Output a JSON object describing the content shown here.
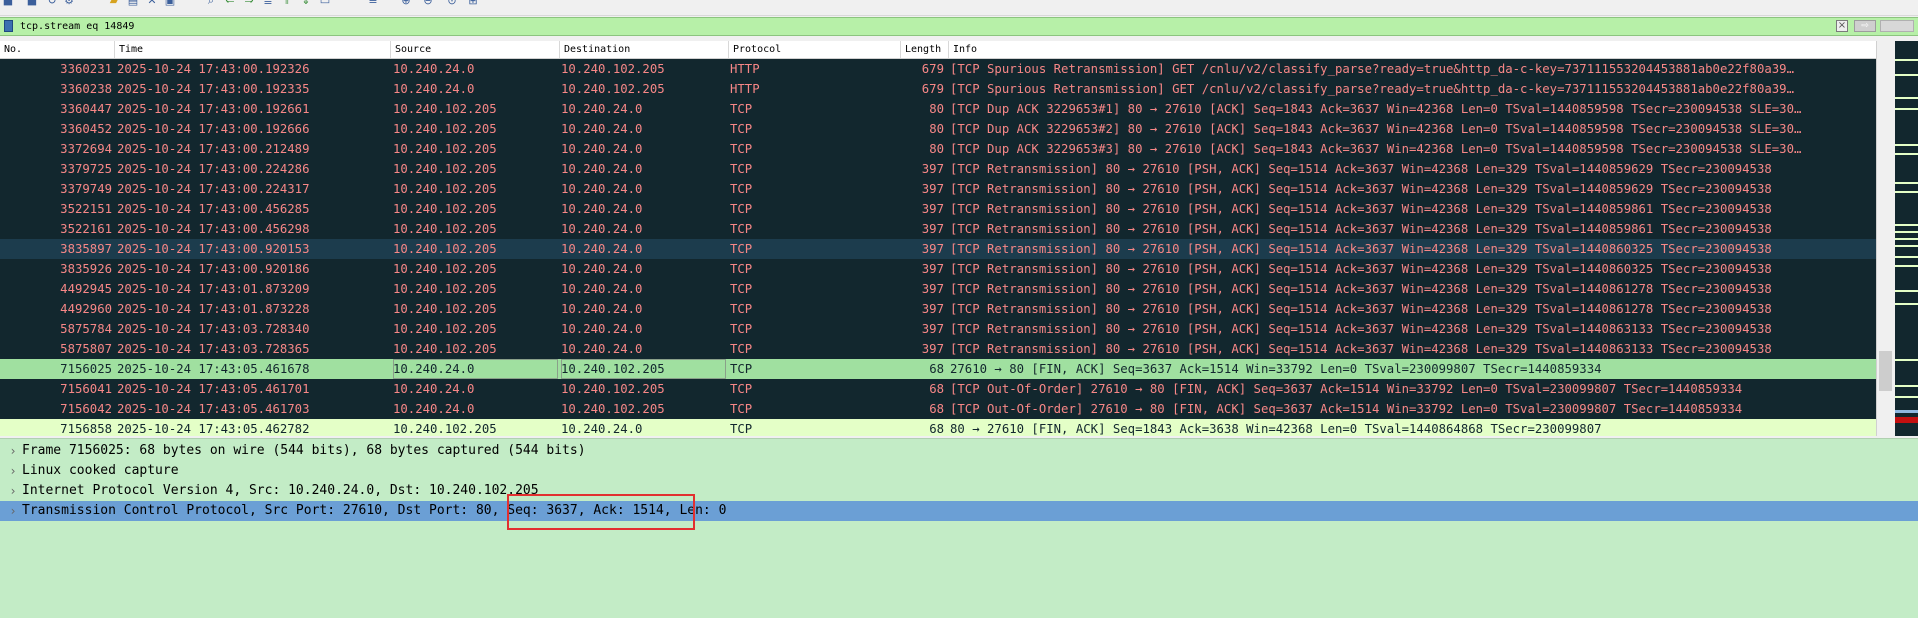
{
  "toolbar": {
    "icons": [
      "stop-icon",
      "restart-icon",
      "options-icon",
      "open-icon",
      "save-icon",
      "close-file-icon",
      "reload-icon",
      "find-icon",
      "go-back-icon",
      "go-forward-icon",
      "go-to-icon",
      "first-icon",
      "last-icon",
      "autoscroll-icon",
      "colorize-icon",
      "zoom-in-icon",
      "zoom-out-icon",
      "zoom-normal-icon",
      "resize-columns-icon"
    ]
  },
  "filter": {
    "value": "tcp.stream eq 14849",
    "clear_icon": "×",
    "apply_icon": "⇨"
  },
  "columns": {
    "no": "No.",
    "time": "Time",
    "source": "Source",
    "destination": "Destination",
    "protocol": "Protocol",
    "length": "Length",
    "info": "Info"
  },
  "packets": [
    {
      "no": "3360231",
      "time": "2025-10-24 17:43:00.192326",
      "src": "10.240.24.0",
      "dst": "10.240.102.205",
      "proto": "HTTP",
      "len": "679",
      "info": "[TCP Spurious Retransmission] GET /cnlu/v2/classify_parse?ready=true&http_da-c-key=737111553204453881ab0e22f80a39…"
    },
    {
      "no": "3360238",
      "time": "2025-10-24 17:43:00.192335",
      "src": "10.240.24.0",
      "dst": "10.240.102.205",
      "proto": "HTTP",
      "len": "679",
      "info": "[TCP Spurious Retransmission] GET /cnlu/v2/classify_parse?ready=true&http_da-c-key=737111553204453881ab0e22f80a39…"
    },
    {
      "no": "3360447",
      "time": "2025-10-24 17:43:00.192661",
      "src": "10.240.102.205",
      "dst": "10.240.24.0",
      "proto": "TCP",
      "len": "80",
      "info": "[TCP Dup ACK 3229653#1] 80 → 27610 [ACK] Seq=1843 Ack=3637 Win=42368 Len=0 TSval=1440859598 TSecr=230094538 SLE=30…"
    },
    {
      "no": "3360452",
      "time": "2025-10-24 17:43:00.192666",
      "src": "10.240.102.205",
      "dst": "10.240.24.0",
      "proto": "TCP",
      "len": "80",
      "info": "[TCP Dup ACK 3229653#2] 80 → 27610 [ACK] Seq=1843 Ack=3637 Win=42368 Len=0 TSval=1440859598 TSecr=230094538 SLE=30…"
    },
    {
      "no": "3372694",
      "time": "2025-10-24 17:43:00.212489",
      "src": "10.240.102.205",
      "dst": "10.240.24.0",
      "proto": "TCP",
      "len": "80",
      "info": "[TCP Dup ACK 3229653#3] 80 → 27610 [ACK] Seq=1843 Ack=3637 Win=42368 Len=0 TSval=1440859598 TSecr=230094538 SLE=30…"
    },
    {
      "no": "3379725",
      "time": "2025-10-24 17:43:00.224286",
      "src": "10.240.102.205",
      "dst": "10.240.24.0",
      "proto": "TCP",
      "len": "397",
      "info": "[TCP Retransmission] 80 → 27610 [PSH, ACK] Seq=1514 Ack=3637 Win=42368 Len=329 TSval=1440859629 TSecr=230094538"
    },
    {
      "no": "3379749",
      "time": "2025-10-24 17:43:00.224317",
      "src": "10.240.102.205",
      "dst": "10.240.24.0",
      "proto": "TCP",
      "len": "397",
      "info": "[TCP Retransmission] 80 → 27610 [PSH, ACK] Seq=1514 Ack=3637 Win=42368 Len=329 TSval=1440859629 TSecr=230094538"
    },
    {
      "no": "3522151",
      "time": "2025-10-24 17:43:00.456285",
      "src": "10.240.102.205",
      "dst": "10.240.24.0",
      "proto": "TCP",
      "len": "397",
      "info": "[TCP Retransmission] 80 → 27610 [PSH, ACK] Seq=1514 Ack=3637 Win=42368 Len=329 TSval=1440859861 TSecr=230094538"
    },
    {
      "no": "3522161",
      "time": "2025-10-24 17:43:00.456298",
      "src": "10.240.102.205",
      "dst": "10.240.24.0",
      "proto": "TCP",
      "len": "397",
      "info": "[TCP Retransmission] 80 → 27610 [PSH, ACK] Seq=1514 Ack=3637 Win=42368 Len=329 TSval=1440859861 TSecr=230094538"
    },
    {
      "no": "3835897",
      "time": "2025-10-24 17:43:00.920153",
      "src": "10.240.102.205",
      "dst": "10.240.24.0",
      "proto": "TCP",
      "len": "397",
      "info": "[TCP Retransmission] 80 → 27610 [PSH, ACK] Seq=1514 Ack=3637 Win=42368 Len=329 TSval=1440860325 TSecr=230094538"
    },
    {
      "no": "3835926",
      "time": "2025-10-24 17:43:00.920186",
      "src": "10.240.102.205",
      "dst": "10.240.24.0",
      "proto": "TCP",
      "len": "397",
      "info": "[TCP Retransmission] 80 → 27610 [PSH, ACK] Seq=1514 Ack=3637 Win=42368 Len=329 TSval=1440860325 TSecr=230094538"
    },
    {
      "no": "4492945",
      "time": "2025-10-24 17:43:01.873209",
      "src": "10.240.102.205",
      "dst": "10.240.24.0",
      "proto": "TCP",
      "len": "397",
      "info": "[TCP Retransmission] 80 → 27610 [PSH, ACK] Seq=1514 Ack=3637 Win=42368 Len=329 TSval=1440861278 TSecr=230094538"
    },
    {
      "no": "4492960",
      "time": "2025-10-24 17:43:01.873228",
      "src": "10.240.102.205",
      "dst": "10.240.24.0",
      "proto": "TCP",
      "len": "397",
      "info": "[TCP Retransmission] 80 → 27610 [PSH, ACK] Seq=1514 Ack=3637 Win=42368 Len=329 TSval=1440861278 TSecr=230094538"
    },
    {
      "no": "5875784",
      "time": "2025-10-24 17:43:03.728340",
      "src": "10.240.102.205",
      "dst": "10.240.24.0",
      "proto": "TCP",
      "len": "397",
      "info": "[TCP Retransmission] 80 → 27610 [PSH, ACK] Seq=1514 Ack=3637 Win=42368 Len=329 TSval=1440863133 TSecr=230094538"
    },
    {
      "no": "5875807",
      "time": "2025-10-24 17:43:03.728365",
      "src": "10.240.102.205",
      "dst": "10.240.24.0",
      "proto": "TCP",
      "len": "397",
      "info": "[TCP Retransmission] 80 → 27610 [PSH, ACK] Seq=1514 Ack=3637 Win=42368 Len=329 TSval=1440863133 TSecr=230094538"
    },
    {
      "no": "7156025",
      "time": "2025-10-24 17:43:05.461678",
      "src": "10.240.24.0",
      "dst": "10.240.102.205",
      "proto": "TCP",
      "len": "68",
      "info": "27610 → 80 [FIN, ACK] Seq=3637 Ack=1514 Win=33792 Len=0 TSval=230099807 TSecr=1440859334"
    },
    {
      "no": "7156041",
      "time": "2025-10-24 17:43:05.461701",
      "src": "10.240.24.0",
      "dst": "10.240.102.205",
      "proto": "TCP",
      "len": "68",
      "info": "[TCP Out-Of-Order] 27610 → 80 [FIN, ACK] Seq=3637 Ack=1514 Win=33792 Len=0 TSval=230099807 TSecr=1440859334"
    },
    {
      "no": "7156042",
      "time": "2025-10-24 17:43:05.461703",
      "src": "10.240.24.0",
      "dst": "10.240.102.205",
      "proto": "TCP",
      "len": "68",
      "info": "[TCP Out-Of-Order] 27610 → 80 [FIN, ACK] Seq=3637 Ack=1514 Win=33792 Len=0 TSval=230099807 TSecr=1440859334"
    },
    {
      "no": "7156858",
      "time": "2025-10-24 17:43:05.462782",
      "src": "10.240.102.205",
      "dst": "10.240.24.0",
      "proto": "TCP",
      "len": "68",
      "info": "80 → 27610 [FIN, ACK] Seq=1843 Ack=3638 Win=42368 Len=0 TSval=1440864868 TSecr=230099807"
    }
  ],
  "details": [
    {
      "text": "Frame 7156025: 68 bytes on wire (544 bits), 68 bytes captured (544 bits)"
    },
    {
      "text": "Linux cooked capture"
    },
    {
      "text": "Internet Protocol Version 4, Src: 10.240.24.0, Dst: 10.240.102.205"
    },
    {
      "text": "Transmission Control Protocol, Src Port: 27610, Dst Port: 80, Seq: 3637, Ack: 1514, Len: 0"
    }
  ],
  "colors": {
    "packet_bg": "#12272e",
    "packet_text": "#f78787",
    "selected_row": "#a0e0a0",
    "detail_bg": "#c3ecc6",
    "detail_selected": "#6b9fd5",
    "filter_bg": "#b7f0a8",
    "highlight_box": "#e23030"
  }
}
